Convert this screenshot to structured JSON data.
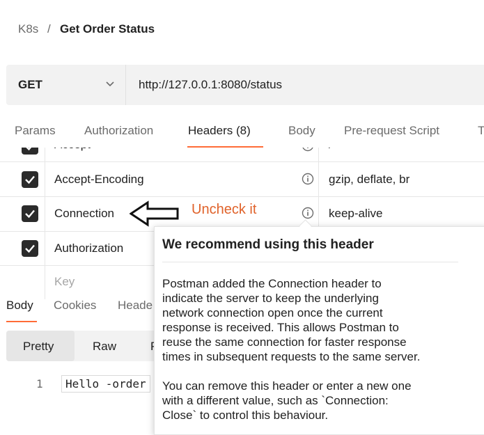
{
  "breadcrumb": {
    "parent": "K8s",
    "separator": "/",
    "title": "Get Order Status"
  },
  "request": {
    "method": "GET",
    "url": "http://127.0.0.1:8080/status"
  },
  "request_tabs": [
    {
      "label": "Params"
    },
    {
      "label": "Authorization"
    },
    {
      "label": "Headers (8)",
      "active": true
    },
    {
      "label": "Body"
    },
    {
      "label": "Pre-request Script"
    },
    {
      "label": "T"
    }
  ],
  "headers": [
    {
      "key": "Accept",
      "value": "/",
      "checked": true
    },
    {
      "key": "Accept-Encoding",
      "value": "gzip, deflate, br",
      "checked": true
    },
    {
      "key": "Connection",
      "value": "keep-alive",
      "checked": true
    },
    {
      "key": "Authorization",
      "value": "",
      "checked": true
    }
  ],
  "new_header": {
    "key_placeholder": "Key"
  },
  "annotation": {
    "text": "Uncheck it",
    "color": "#e0622a"
  },
  "response_tabs": [
    {
      "label": "Body",
      "active": true
    },
    {
      "label": "Cookies"
    },
    {
      "label": "Heade"
    }
  ],
  "view_modes": [
    {
      "label": "Pretty",
      "active": true
    },
    {
      "label": "Raw"
    },
    {
      "label": "P"
    }
  ],
  "response_body": {
    "line_number": "1",
    "text": "Hello -order"
  },
  "tooltip": {
    "title": "We recommend using this header",
    "para1_lines": [
      "Postman added the Connection header to",
      "indicate the server to keep the underlying",
      "network connection open once the current",
      "response is received. This allows Postman to",
      "reuse the same connection for faster response",
      "times in subsequent requests to the same server."
    ],
    "para2_lines": [
      "You can remove this header or enter a new one",
      "with a different value, such as `Connection:",
      "Close` to control this behaviour."
    ]
  },
  "colors": {
    "accent": "#ff6c37",
    "checkbox": "#2b2b2b"
  }
}
